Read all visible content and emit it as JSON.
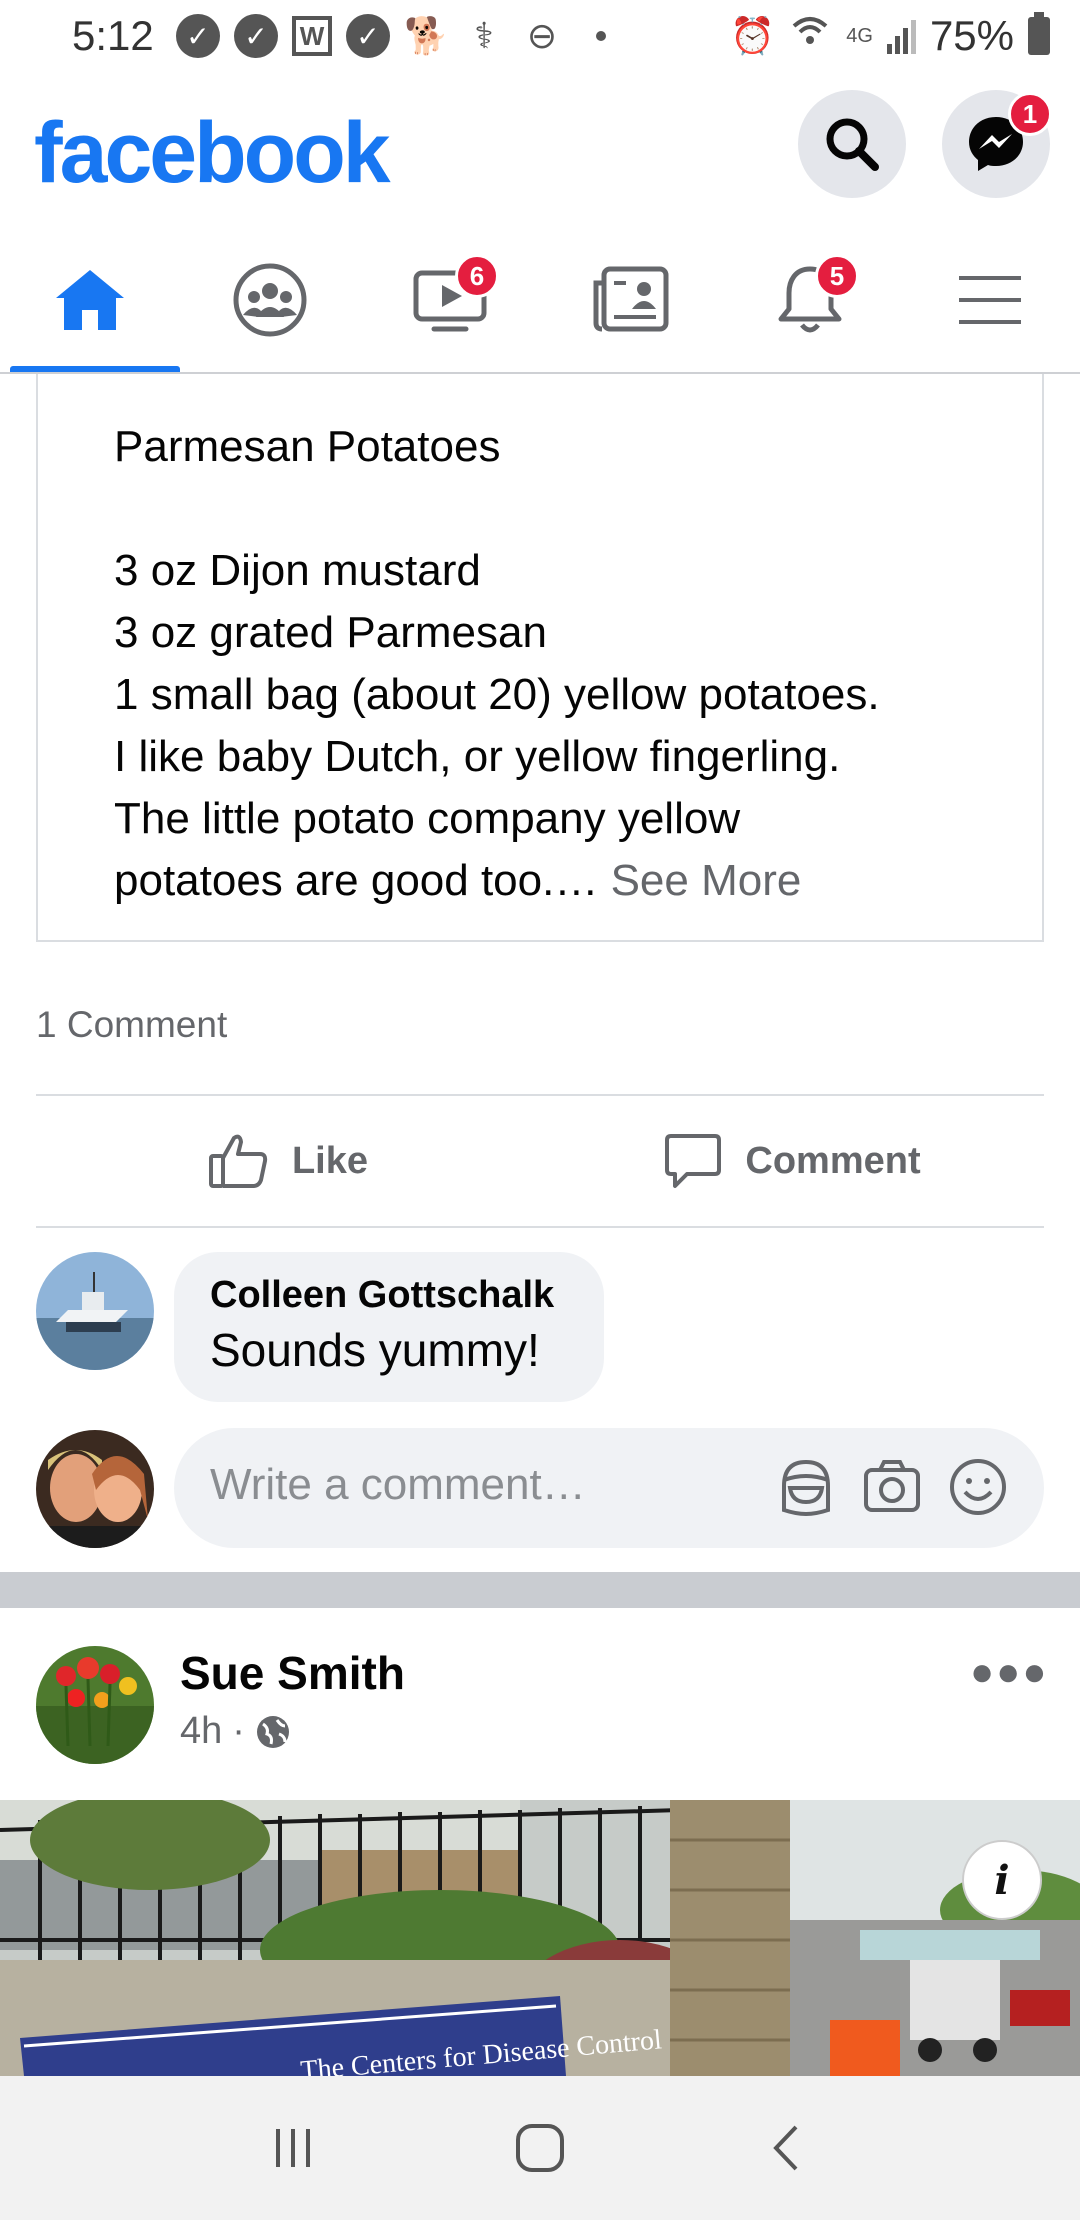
{
  "status_bar": {
    "time": "5:12",
    "left_icons": [
      "check-circle-icon",
      "check-circle-icon",
      "w-app-icon",
      "check-circle-icon",
      "dog-icon",
      "pet-icon",
      "dnd-icon"
    ],
    "network": "4G",
    "battery": "75%"
  },
  "header": {
    "logo": "facebook",
    "messenger_badge": "1",
    "brand_color": "#1877f2"
  },
  "tabs": [
    {
      "name": "home",
      "active": true,
      "badge": ""
    },
    {
      "name": "groups",
      "active": false,
      "badge": ""
    },
    {
      "name": "watch",
      "active": false,
      "badge": "6"
    },
    {
      "name": "news",
      "active": false,
      "badge": ""
    },
    {
      "name": "notifications",
      "active": false,
      "badge": "5"
    },
    {
      "name": "menu",
      "active": false,
      "badge": ""
    }
  ],
  "recipe": {
    "title": "Parmesan Potatoes",
    "lines": [
      "3 oz Dijon mustard",
      "3 oz grated Parmesan",
      "1 small bag (about 20) yellow potatoes.",
      "I like baby Dutch,  or yellow fingerling.",
      "The little potato company yellow",
      "potatoes are good too.… "
    ],
    "see_more": "See More"
  },
  "post_stats": {
    "comments": "1 Comment"
  },
  "actions": {
    "like": "Like",
    "comment": "Comment"
  },
  "comment": {
    "author": "Colleen Gottschalk",
    "text": "Sounds yummy!"
  },
  "write_comment": {
    "placeholder": "Write a comment…"
  },
  "next_post": {
    "author": "Sue Smith",
    "time": "4h",
    "sign_text": "The Centers for Disease Control"
  }
}
